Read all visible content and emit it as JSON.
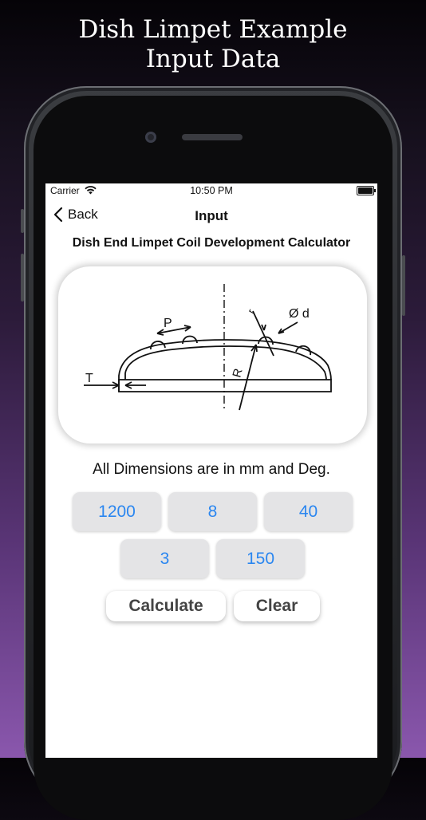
{
  "promo": {
    "headline_line1": "Dish Limpet Example",
    "headline_line2": "Input Data"
  },
  "status_bar": {
    "carrier": "Carrier",
    "time": "10:50 PM"
  },
  "nav": {
    "back_label": "Back",
    "title": "Input"
  },
  "calculator_title": "Dish End Limpet Coil Development Calculator",
  "diagram": {
    "label_pitch": "P",
    "label_diameter": "Ø d",
    "label_thickness": "T",
    "label_radius": "R",
    "label_r": "r"
  },
  "units_text": "All Dimensions are in mm and Deg.",
  "inputs": [
    {
      "value": "1200"
    },
    {
      "value": "8"
    },
    {
      "value": "40"
    },
    {
      "value": "3"
    },
    {
      "value": "150"
    }
  ],
  "actions": {
    "calculate_label": "Calculate",
    "clear_label": "Clear"
  },
  "colors": {
    "input_text": "#2a86f0",
    "input_bg": "#e4e4e6",
    "button_text": "#444444"
  }
}
